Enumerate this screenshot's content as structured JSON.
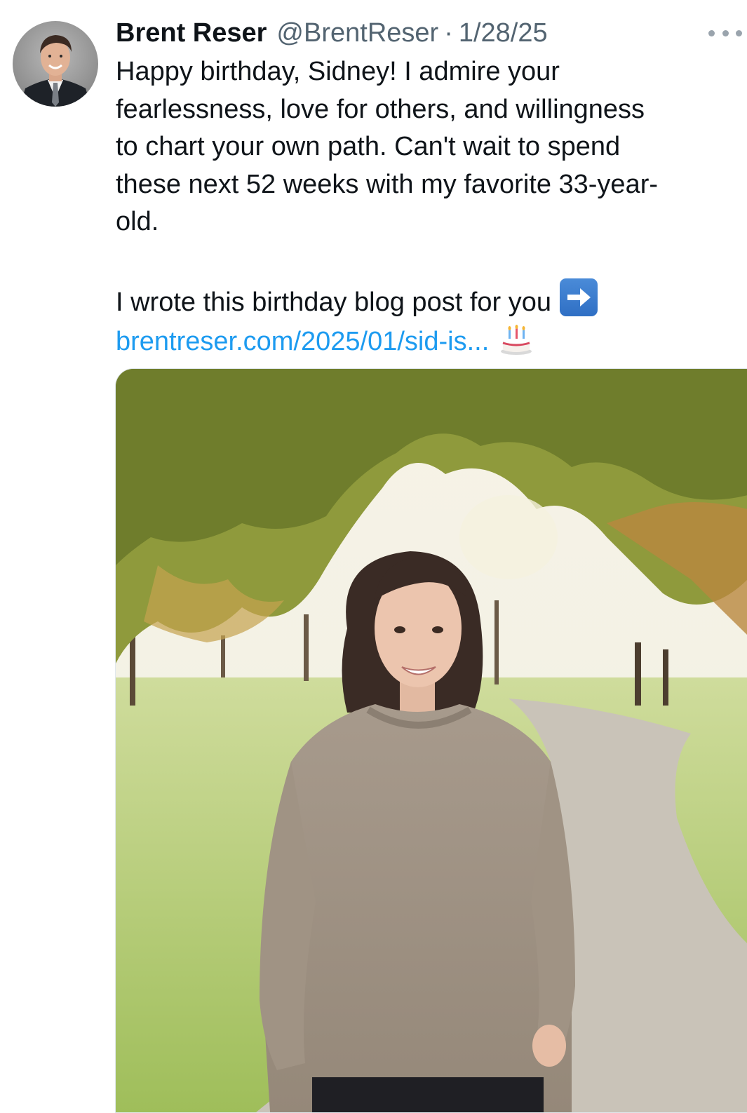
{
  "tweet": {
    "display_name": "Brent Reser",
    "handle": "@BrentReser",
    "separator": "·",
    "date": "1/28/25",
    "text_lines": [
      "Happy birthday, Sidney! I admire your",
      "fearlessness, love for others, and willingness",
      "to chart your own path. Can't wait to spend",
      "these next 52 weeks with my favorite 33-year-",
      "old."
    ],
    "blog_line": "I wrote this birthday blog post for you",
    "link_text": "brentreser.com/2025/01/sid-is...",
    "icons": {
      "avatar": "profile-photo",
      "more": "more-options-icon",
      "arrow": "right-arrow-emoji",
      "cake": "birthday-cake-emoji"
    }
  },
  "colors": {
    "text": "#0f1419",
    "secondary": "#536471",
    "link": "#1d9bf0"
  }
}
